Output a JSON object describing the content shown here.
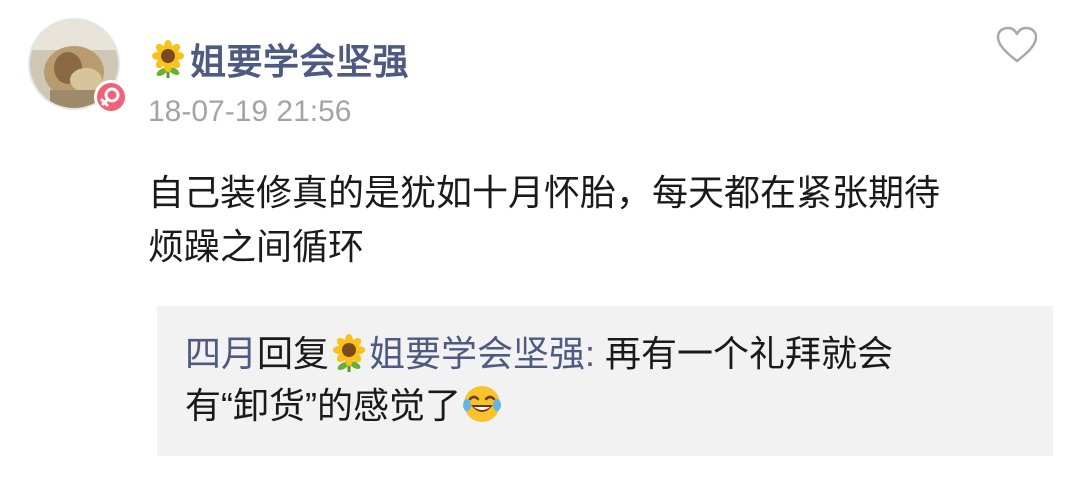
{
  "comment": {
    "username_emoji": "sunflower-icon",
    "username": "姐要学会坚强",
    "timestamp": "18-07-19 21:56",
    "body_line1": "自己装修真的是犹如十月怀胎，每天都在紧张期待",
    "body_line2": "烦躁之间循环",
    "like_icon": "heart-outline-icon",
    "gender_icon": "female-icon"
  },
  "reply": {
    "author": "四月",
    "verb": "回复",
    "target_emoji": "sunflower-icon",
    "target": "姐要学会坚强:",
    "text_line1": " 再有一个礼拜就会",
    "text_line2": "有“卸货”的感觉了",
    "end_emoji": "laughing-tears-icon"
  },
  "colors": {
    "link": "#4e5a82",
    "timestamp": "#a4a4a4",
    "reply_bg": "#f2f2f2",
    "badge": "#f06277"
  }
}
